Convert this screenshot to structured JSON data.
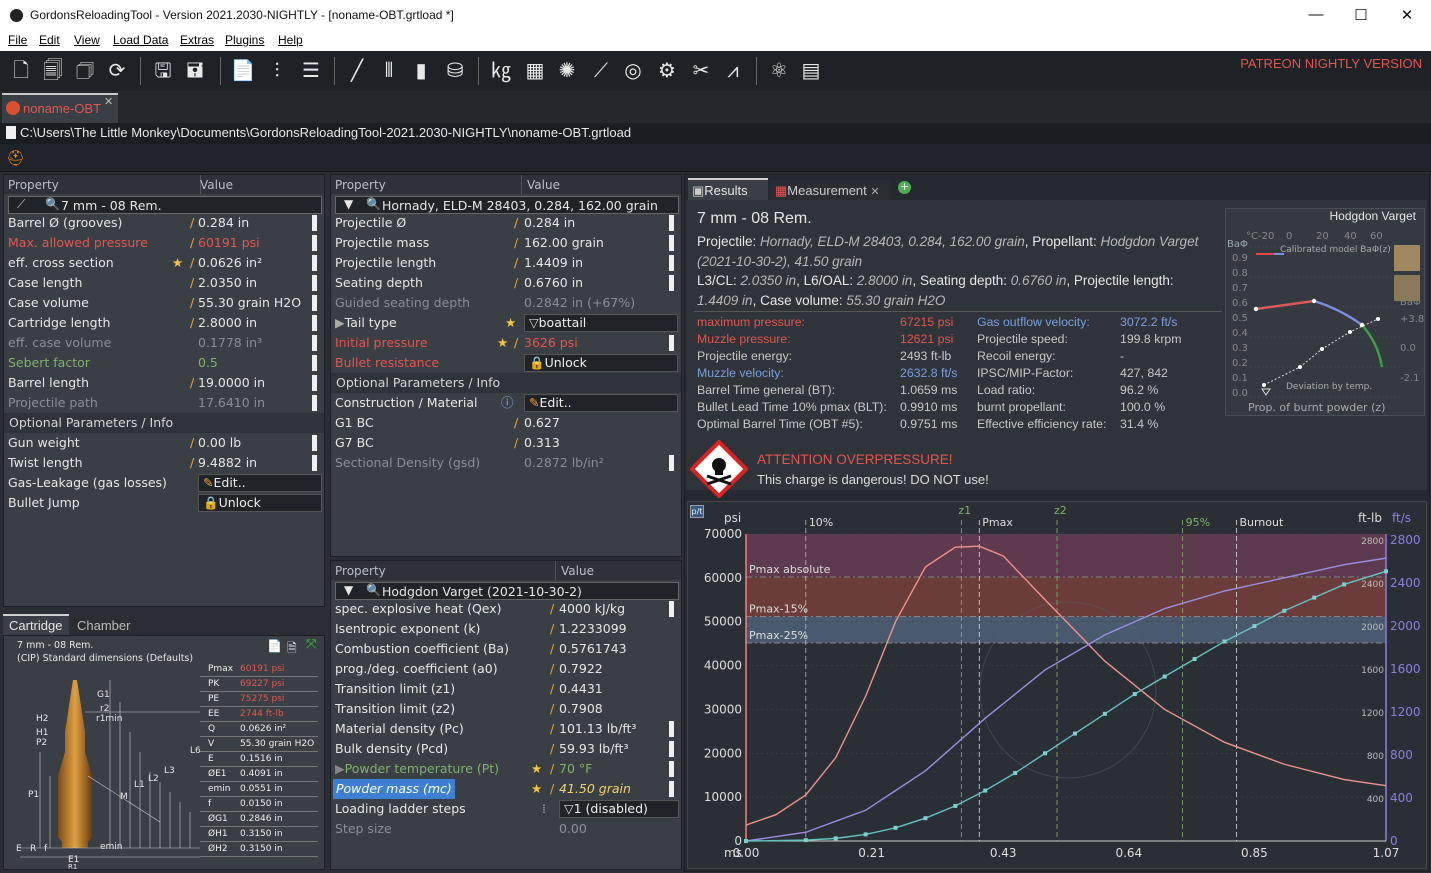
{
  "window": {
    "title": "GordonsReloadingTool - Version 2021.2030-NIGHTLY - [noname-OBT.grtload *]",
    "minimize": "—",
    "maximize": "☐",
    "close": "✕"
  },
  "menu": [
    "File",
    "Edit",
    "View",
    "Load Data",
    "Extras",
    "Plugins",
    "Help"
  ],
  "patreon_label": "PATREON NIGHTLY VERSION",
  "doc_tab": {
    "label": "noname-OBT",
    "close": "✕"
  },
  "path": "C:\\Users\\The Little Monkey\\Documents\\GordonsReloadingTool-2021.2030-NIGHTLY\\noname-OBT.grtload",
  "cartridge_grid": {
    "header_property": "Property",
    "header_value": "Value",
    "selector": "7 mm - 08 Rem.",
    "rows": [
      {
        "k": "Barrel Ø (grooves)",
        "v": "0.284 in"
      },
      {
        "k": "Max. allowed pressure",
        "v": "60191 psi"
      },
      {
        "k": "eff. cross section",
        "v": "0.0626 in²"
      },
      {
        "k": "Case length",
        "v": "2.0350 in"
      },
      {
        "k": "Case volume",
        "v": "55.30 grain H2O"
      },
      {
        "k": "Cartridge length",
        "v": "2.8000 in"
      },
      {
        "k": "eff. case volume",
        "v": "0.1778 in³"
      },
      {
        "k": "Sebert factor",
        "v": "0.5"
      },
      {
        "k": "Barrel length",
        "v": "19.0000 in"
      },
      {
        "k": "Projectile path",
        "v": "17.6410 in"
      }
    ],
    "optional_title": "Optional Parameters / Info",
    "optional_rows": [
      {
        "k": "Gun weight",
        "v": "0.00 lb"
      },
      {
        "k": "Twist length",
        "v": "9.4882 in"
      },
      {
        "k": "Gas-Leakage (gas losses)",
        "v": "Edit.."
      },
      {
        "k": "Bullet Jump",
        "v": "Unlock"
      }
    ]
  },
  "projectile_grid": {
    "header_property": "Property",
    "header_value": "Value",
    "selector": "Hornady, ELD-M 28403, 0.284, 162.00 grain",
    "rows": [
      {
        "k": "Projectile Ø",
        "v": "0.284 in"
      },
      {
        "k": "Projectile mass",
        "v": "162.00 grain"
      },
      {
        "k": "Projectile length",
        "v": "1.4409 in"
      },
      {
        "k": "Seating depth",
        "v": "0.6760 in"
      },
      {
        "k": "Guided seating depth",
        "v": "0.2842 in (+67%)"
      },
      {
        "k": "Tail type",
        "v": "boattail"
      },
      {
        "k": "Initial pressure",
        "v": "3626 psi"
      },
      {
        "k": "Bullet resistance",
        "v": "Unlock"
      }
    ],
    "optional_title": "Optional Parameters / Info",
    "optional_rows": [
      {
        "k": "Construction / Material",
        "v": "Edit.."
      },
      {
        "k": "G1 BC",
        "v": "0.627"
      },
      {
        "k": "G7 BC",
        "v": "0.313"
      },
      {
        "k": "Sectional Density (gsd)",
        "v": "0.2872 lb/in²"
      }
    ]
  },
  "powder_grid": {
    "header_property": "Property",
    "header_value": "Value",
    "selector": "Hodgdon Varget (2021-10-30-2)",
    "rows": [
      {
        "k": "spec. explosive heat (Qex)",
        "v": "4000 kJ/kg"
      },
      {
        "k": "Isentropic exponent (k)",
        "v": "1.2233099"
      },
      {
        "k": "Combustion coefficient (Ba)",
        "v": "0.5761743"
      },
      {
        "k": "prog./deg. coefficient (a0)",
        "v": "0.7922"
      },
      {
        "k": "Transition limit (z1)",
        "v": "0.4431"
      },
      {
        "k": "Transition limit (z2)",
        "v": "0.7908"
      },
      {
        "k": "Material density (Pc)",
        "v": "101.13 lb/ft³"
      },
      {
        "k": "Bulk density (Pcd)",
        "v": "59.93 lb/ft³"
      },
      {
        "k": "Powder temperature (Pt)",
        "v": "70 °F"
      },
      {
        "k": "Powder mass (mc)",
        "v": "41.50 grain"
      },
      {
        "k": "Loading ladder steps",
        "v": "1 (disabled)"
      },
      {
        "k": "Step size",
        "v": "0.00"
      }
    ]
  },
  "cartridge_tabs": [
    "Cartridge",
    "Chamber"
  ],
  "drawing": {
    "title": "7 mm - 08 Rem.",
    "subtitle": "(CIP) Standard dimensions (Defaults)",
    "labels": [
      "G1",
      "r2",
      "r1min",
      "H2",
      "H1",
      "P2",
      "L6",
      "L3",
      "L2",
      "L1",
      "M",
      "P1",
      "E",
      "R",
      "f",
      "emin",
      "E1",
      "R1"
    ],
    "table": [
      {
        "k": "Pmax",
        "v": "60191 psi"
      },
      {
        "k": "PK",
        "v": "69227 psi"
      },
      {
        "k": "PE",
        "v": "75275 psi"
      },
      {
        "k": "EE",
        "v": "2744 ft-lb"
      },
      {
        "k": "Q",
        "v": "0.0626 in²"
      },
      {
        "k": "V",
        "v": "55.30 grain H2O"
      },
      {
        "k": "E",
        "v": "0.1516 in"
      },
      {
        "k": "ØE1",
        "v": "0.4091 in"
      },
      {
        "k": "emin",
        "v": "0.0551 in"
      },
      {
        "k": "f",
        "v": "0.0150 in"
      },
      {
        "k": "ØG1",
        "v": "0.2846 in"
      },
      {
        "k": "ØH1",
        "v": "0.3150 in"
      },
      {
        "k": "ØH2",
        "v": "0.3150 in"
      }
    ]
  },
  "results_tabs": [
    "Results",
    "Measurement"
  ],
  "results": {
    "title": "7 mm - 08 Rem.",
    "desc": [
      {
        "l": "Projectile: ",
        "v": "Hornady, ELD-M 28403, 0.284, 162.00 grain"
      },
      {
        "l": ", Propellant: ",
        "v": "Hodgdon Varget"
      },
      {
        "l": "",
        "v": "(2021-10-30-2), 41.50 grain"
      },
      {
        "l": "L3/CL: ",
        "v": "2.0350 in"
      },
      {
        "l": ", L6/OAL: ",
        "v": "2.8000 in"
      },
      {
        "l": ", Seating depth: ",
        "v": "0.6760 in"
      },
      {
        "l": ", Projectile length:",
        "v": ""
      },
      {
        "l": "",
        "v": "1.4409 in"
      },
      {
        "l": ", Case volume: ",
        "v": "55.30 grain H2O"
      }
    ],
    "left": [
      {
        "k": "maximum pressure:",
        "v": "67215 psi"
      },
      {
        "k": "Muzzle pressure:",
        "v": "12621 psi"
      },
      {
        "k": "Projectile energy:",
        "v": "2493 ft-lb"
      },
      {
        "k": "Muzzle velocity:",
        "v": "2632.8 ft/s"
      },
      {
        "k": "Barrel Time general (BT):",
        "v": "1.0659 ms"
      },
      {
        "k": "Bullet Lead Time 10% pmax (BLT):",
        "v": "0.9910 ms"
      },
      {
        "k": "Optimal Barrel Time (OBT #5):",
        "v": "0.9751 ms"
      }
    ],
    "right": [
      {
        "k": "Gas outflow velocity:",
        "v": "3072.2 ft/s"
      },
      {
        "k": "Projectile speed:",
        "v": "199.8 krpm"
      },
      {
        "k": "Recoil energy:",
        "v": "-"
      },
      {
        "k": "IPSC/MIP-Factor:",
        "v": "427, 842"
      },
      {
        "k": "Load ratio:",
        "v": "96.2 %"
      },
      {
        "k": "burnt propellant:",
        "v": "100.0 %"
      },
      {
        "k": "Effective efficiency rate:",
        "v": "31.4 %"
      }
    ],
    "warning_title": "ATTENTION OVERPRESSURE!",
    "warning_text": "This charge is dangerous! DO NOT use!"
  },
  "mini_chart": {
    "title": "Hodgdon Varget",
    "ylabel": "BaΦ",
    "y_ticks": [
      "0.9",
      "0.8",
      "0.7",
      "0.6",
      "0.5",
      "0.4",
      "0.3",
      "0.2",
      "0.1",
      "0.0"
    ],
    "x_ticks": [
      "°C-20",
      "0",
      "20",
      "40",
      "60"
    ],
    "calibrated_label": "Calibrated model BaΦ(z)",
    "deviation_label": "Deviation by temp.",
    "bottom_label": "Prop. of burnt powder (z)",
    "right_ticks": [
      "BaΦ",
      "+3.8",
      "0.0",
      "-2.1"
    ]
  },
  "chart_data": {
    "type": "line",
    "y_left_unit": "psi",
    "y_right_units": [
      "ft-lb",
      "ft/s"
    ],
    "x_unit": "ms",
    "x_ticks": [
      "0.00",
      "0.21",
      "0.43",
      "0.64",
      "0.85",
      "1.07"
    ],
    "y_left_ticks": [
      "70000",
      "60000",
      "50000",
      "40000",
      "30000",
      "20000",
      "10000",
      "0"
    ],
    "y_right1_ticks": [
      "2800",
      "2400",
      "2000",
      "1600",
      "1200",
      "800",
      "400"
    ],
    "y_right2_ticks": [
      "2800",
      "2400",
      "2000",
      "1600",
      "1200",
      "800",
      "400",
      "0"
    ],
    "xlim": [
      0,
      1.07
    ],
    "ylim": [
      0,
      70000
    ],
    "bands": [
      {
        "label": "Pmax absolute",
        "value": 60191
      },
      {
        "label": "Pmax-15%",
        "value": 51162
      },
      {
        "label": "Pmax-25%",
        "value": 45143
      }
    ],
    "markers": [
      {
        "label": "10%",
        "x": 0.1
      },
      {
        "label": "z1",
        "x": 0.36
      },
      {
        "label": "Pmax",
        "x": 0.39
      },
      {
        "label": "z2",
        "x": 0.52
      },
      {
        "label": "95%",
        "x": 0.73
      },
      {
        "label": "Burnout",
        "x": 0.82
      }
    ],
    "series": [
      {
        "name": "",
        "color": "#f09090",
        "x": [
          0.0,
          0.05,
          0.1,
          0.15,
          0.2,
          0.25,
          0.3,
          0.35,
          0.39,
          0.43,
          0.5,
          0.6,
          0.7,
          0.8,
          0.9,
          1.0,
          1.07
        ],
        "y": [
          3626,
          6000,
          10500,
          19000,
          33000,
          50000,
          62500,
          67000,
          67215,
          65000,
          55000,
          41000,
          30000,
          22500,
          17500,
          14000,
          12621
        ]
      },
      {
        "name": "",
        "color": "#9a8fe0",
        "x": [
          0.0,
          0.1,
          0.2,
          0.3,
          0.4,
          0.5,
          0.6,
          0.7,
          0.8,
          0.9,
          1.0,
          1.07
        ],
        "y": [
          0,
          2000,
          7000,
          16000,
          28000,
          39000,
          47000,
          53000,
          57000,
          60000,
          63000,
          64500
        ]
      },
      {
        "name": "",
        "color": "#66c2c0",
        "x": [
          0.0,
          0.1,
          0.15,
          0.2,
          0.25,
          0.3,
          0.35,
          0.4,
          0.45,
          0.5,
          0.55,
          0.6,
          0.65,
          0.7,
          0.75,
          0.8,
          0.85,
          0.9,
          0.95,
          1.0,
          1.07
        ],
        "y": [
          0,
          200,
          600,
          1500,
          3000,
          5200,
          8000,
          11500,
          15500,
          20000,
          24500,
          29000,
          33500,
          37500,
          41500,
          45500,
          49000,
          52500,
          55500,
          58500,
          61500
        ]
      }
    ]
  }
}
